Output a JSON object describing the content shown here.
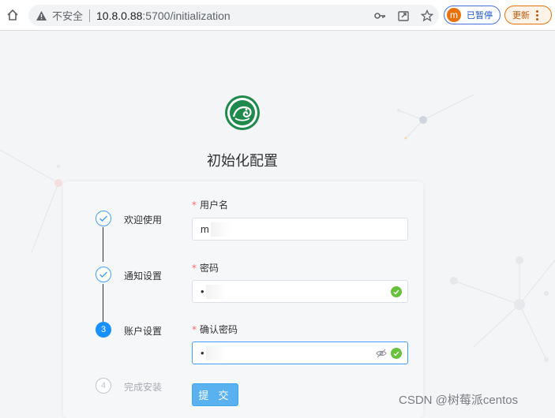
{
  "browser": {
    "insecure_label": "不安全",
    "url_host": "10.8.0.88",
    "url_rest": ":5700/initialization",
    "profile_initial": "m",
    "profile_status": "已暂停",
    "update_label": "更新",
    "icons": [
      "home-icon",
      "warning-icon",
      "key-icon",
      "share-icon",
      "star-icon",
      "more-icon"
    ]
  },
  "page": {
    "title": "初始化配置",
    "logo_icon": "dragon-logo-icon"
  },
  "steps": [
    {
      "label": "欢迎使用",
      "status": "done"
    },
    {
      "label": "通知设置",
      "status": "done"
    },
    {
      "label": "账户设置",
      "number": "3",
      "status": "active"
    },
    {
      "label": "完成安装",
      "number": "4",
      "status": "wait"
    }
  ],
  "form": {
    "username": {
      "label": "用户名",
      "value": "m",
      "required": true
    },
    "password": {
      "label": "密码",
      "value": "•",
      "required": true,
      "valid": true
    },
    "confirm_password": {
      "label": "确认密码",
      "value": "•",
      "required": true,
      "valid": true,
      "focused": true
    },
    "submit_label": "提 交"
  },
  "watermark": "CSDN @树莓派centos",
  "colors": {
    "primary": "#409eff",
    "active_step": "#1890ff",
    "required": "#f56c6c",
    "success": "#67c23a",
    "submit": "#59b2ef"
  }
}
